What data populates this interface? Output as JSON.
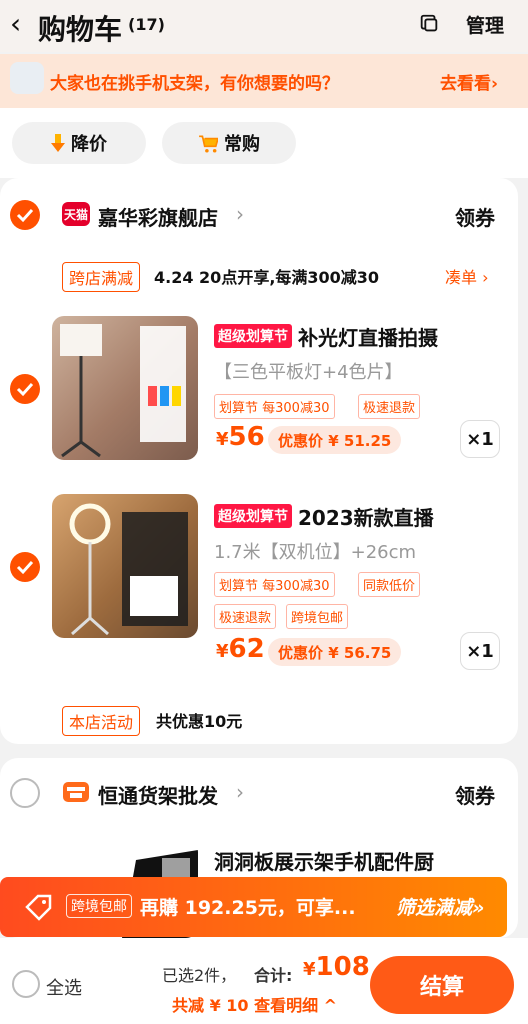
{
  "header": {
    "title": "购物车",
    "count": "(17)",
    "manage": "管理",
    "icons": {
      "back": "chevron-left-icon",
      "multi": "copy-icon"
    }
  },
  "banner": {
    "text": "大家也在挑手机支架，有你想要的吗？",
    "link": "去看看›"
  },
  "filters": [
    {
      "label": "降价",
      "icon": "price-drop-icon"
    },
    {
      "label": "常购",
      "icon": "cart-icon"
    }
  ],
  "store1": {
    "badge": "天猫",
    "name": "嘉华彩旗舰店",
    "coupon": "领券",
    "promo_tag": "跨店满减",
    "promo_text": "4.24 20点开享,每满300减30",
    "promo_link": "凑单 ›"
  },
  "product1": {
    "tag": "超级划算节",
    "title": "补光灯直播拍摄",
    "sku": "【三色平板灯+4色片】",
    "tags": [
      "划算节 每300减30",
      "极速退款"
    ],
    "price_symbol": "¥",
    "price": "56",
    "deal": "优惠价 ¥ 51.25",
    "qty": "×1"
  },
  "product2": {
    "tag": "超级划算节",
    "title": "2023新款直播",
    "sku": "1.7米【双机位】+26cm",
    "tags": [
      "划算节 每300减30",
      "同款低价",
      "极速退款",
      "跨境包邮"
    ],
    "price_symbol": "¥",
    "price": "62",
    "deal": "优惠价 ¥ 56.75",
    "qty": "×1"
  },
  "store_activity": {
    "tag": "本店活动",
    "text": "共优惠10元"
  },
  "store2": {
    "name": "恒通货架批发",
    "coupon": "领券"
  },
  "product3": {
    "title": "洞洞板展示架手机配件厨"
  },
  "orange_bar": {
    "tag": "跨境包邮",
    "text": "再購 192.25元，可享...",
    "link": "筛选满减»"
  },
  "footer": {
    "select_all": "全选",
    "selected_count": "已选2件，",
    "total_label": "合计:",
    "total_symbol": "¥",
    "total_price": "108",
    "saving": "共减 ¥ 10  查看明细 ^",
    "checkout": "结算"
  },
  "colors": {
    "accent": "#ff5000",
    "tag_red": "#ff1744"
  }
}
